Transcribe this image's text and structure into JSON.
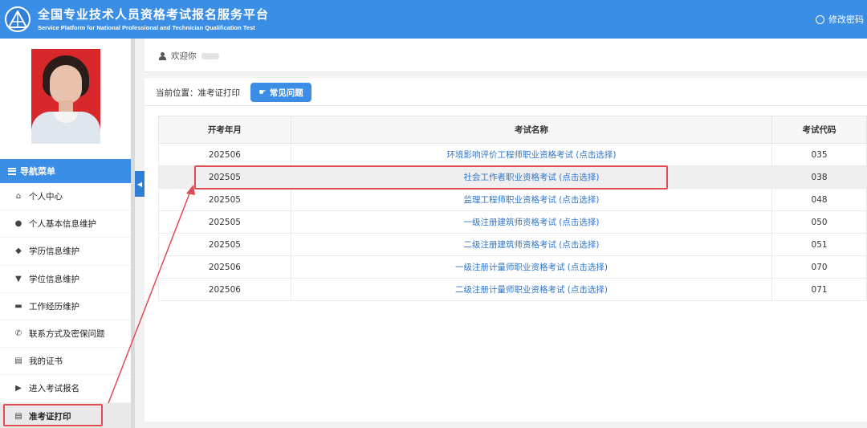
{
  "header": {
    "title": "全国专业技术人员资格考试报名服务平台",
    "subtitle": "Service Platform for National Professional and Technician Qualification Test",
    "change_password": "修改密码"
  },
  "sidebar": {
    "nav_title": "导航菜单",
    "items": [
      {
        "label": "个人中心",
        "icon": "home-icon",
        "glyph": "⌂"
      },
      {
        "label": "个人基本信息维护",
        "icon": "user-icon",
        "glyph": "●"
      },
      {
        "label": "学历信息维护",
        "icon": "graduation-cap-icon",
        "glyph": "◆"
      },
      {
        "label": "学位信息维护",
        "icon": "degree-icon",
        "glyph": "▼"
      },
      {
        "label": "工作经历维护",
        "icon": "briefcase-icon",
        "glyph": "▬"
      },
      {
        "label": "联系方式及密保问题",
        "icon": "phone-icon",
        "glyph": "✆"
      },
      {
        "label": "我的证书",
        "icon": "certificate-icon",
        "glyph": "▤"
      },
      {
        "label": "进入考试报名",
        "icon": "play-circle-icon",
        "glyph": "▶"
      },
      {
        "label": "准考证打印",
        "icon": "document-icon",
        "glyph": "▤"
      }
    ]
  },
  "welcome": {
    "text": "欢迎你"
  },
  "breadcrumb": {
    "text": "当前位置：准考证打印"
  },
  "faq_button": {
    "label": "常见问题"
  },
  "table": {
    "headers": [
      "开考年月",
      "考试名称",
      "考试代码"
    ],
    "rows": [
      [
        "202506",
        "环境影响评价工程师职业资格考试 (点击选择)",
        "035"
      ],
      [
        "202505",
        "社会工作者职业资格考试 (点击选择)",
        "038"
      ],
      [
        "202505",
        "监理工程师职业资格考试 (点击选择)",
        "048"
      ],
      [
        "202505",
        "一级注册建筑师资格考试 (点击选择)",
        "050"
      ],
      [
        "202505",
        "二级注册建筑师资格考试 (点击选择)",
        "051"
      ],
      [
        "202506",
        "一级注册计量师职业资格考试 (点击选择)",
        "070"
      ],
      [
        "202506",
        "二级注册计量师职业资格考试 (点击选择)",
        "071"
      ]
    ]
  },
  "colors": {
    "primary": "#3a8ee6",
    "link": "#2f76c8",
    "annotation": "#e04b55"
  }
}
